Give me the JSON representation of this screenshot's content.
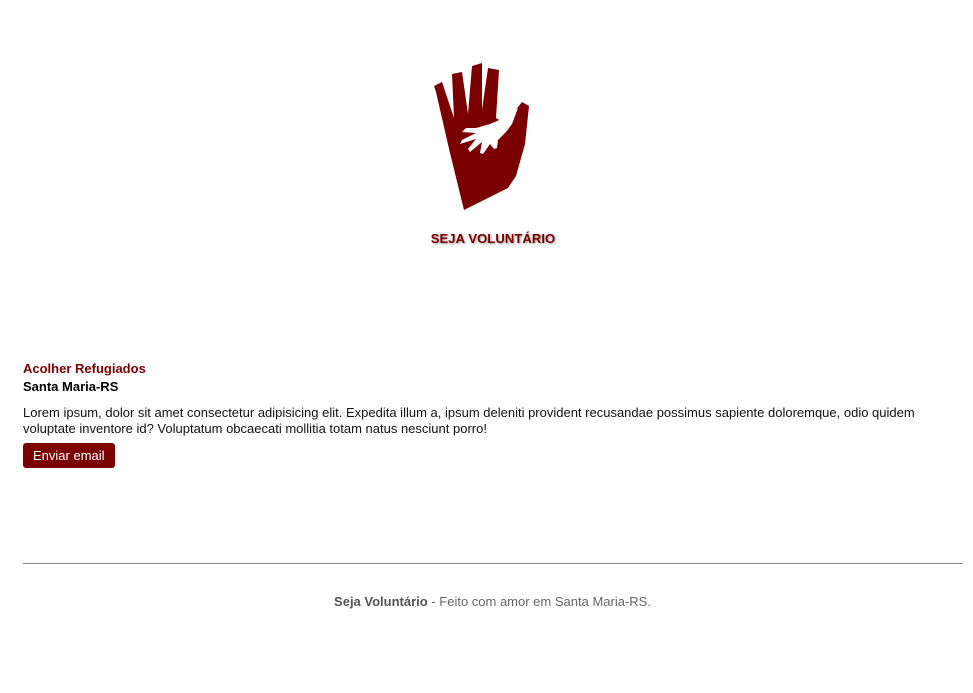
{
  "header": {
    "title": "SEJA VOLUNTÁRIO",
    "logo_icon": "helping-hands-icon"
  },
  "cause": {
    "title": "Acolher Refugiados",
    "location": "Santa Maria-RS",
    "description": "Lorem ipsum, dolor sit amet consectetur adipisicing elit. Expedita illum a, ipsum deleniti provident recusandae possimus sapiente doloremque, odio quidem voluptate inventore id? Voluptatum obcaecati mollitia totam natus nesciunt porro!",
    "button_label": "Enviar email"
  },
  "footer": {
    "brand": "Seja Voluntário",
    "text": " - Feito com amor em Santa Maria-RS."
  },
  "colors": {
    "brand": "#7b0000",
    "divider": "#888888"
  }
}
